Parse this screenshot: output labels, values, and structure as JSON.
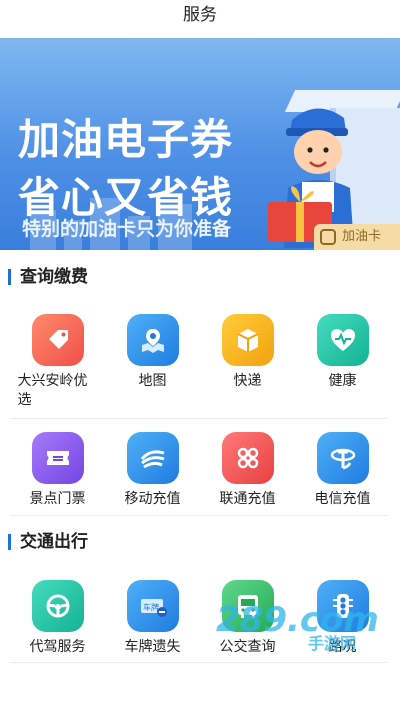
{
  "header": {
    "title": "服务"
  },
  "banner": {
    "line1": "加油电子券",
    "line2": "省心又省钱",
    "line3": "特别的加油卡只为你准备",
    "corner_tag": "加油卡"
  },
  "sections": [
    {
      "title": "查询缴费",
      "items": [
        {
          "label": "大兴安岭优选",
          "icon": "tag-icon",
          "color": "#f26b4f"
        },
        {
          "label": "地图",
          "icon": "map-icon",
          "color": "#2f8ff0"
        },
        {
          "label": "快递",
          "icon": "package-icon",
          "color": "#f5b01f"
        },
        {
          "label": "健康",
          "icon": "heart-icon",
          "color": "#26c3a9"
        },
        {
          "label": "景点门票",
          "icon": "ticket-icon",
          "color": "#8a5cf0"
        },
        {
          "label": "移动充值",
          "icon": "mobile-carrier-icon",
          "color": "#2f8ff0"
        },
        {
          "label": "联通充值",
          "icon": "unicom-icon",
          "color": "#f15a5a"
        },
        {
          "label": "电信充值",
          "icon": "telecom-icon",
          "color": "#2f8ff0"
        }
      ]
    },
    {
      "title": "交通出行",
      "items": [
        {
          "label": "代驾服务",
          "icon": "steering-wheel-icon",
          "color": "#26c3a9"
        },
        {
          "label": "车牌遗失",
          "icon": "license-plate-icon",
          "color": "#2f8ff0"
        },
        {
          "label": "公交查询",
          "icon": "bus-icon",
          "color": "#3fbf6a"
        },
        {
          "label": "路况",
          "icon": "traffic-light-icon",
          "color": "#2f8ff0"
        }
      ]
    }
  ],
  "watermark": {
    "text": "289.com",
    "sub": "手游网"
  }
}
